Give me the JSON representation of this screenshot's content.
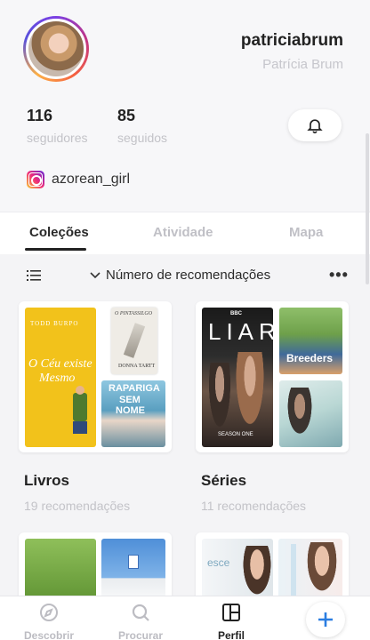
{
  "profile": {
    "username": "patriciabrum",
    "full_name": "Patrícia Brum",
    "followers_count": "116",
    "followers_label": "seguidores",
    "following_count": "85",
    "following_label": "seguidos",
    "instagram_handle": "azorean_girl"
  },
  "tabs": [
    {
      "label": "Coleções",
      "active": true
    },
    {
      "label": "Atividade",
      "active": false
    },
    {
      "label": "Mapa",
      "active": false
    }
  ],
  "sort": {
    "label": "Número de recomendações"
  },
  "collections": [
    {
      "title": "Livros",
      "count": "19 recomendações",
      "covers": {
        "main": {
          "lines": [
            "TODD BURPO",
            "O Céu existe",
            "Mesmo"
          ]
        },
        "top_right": {
          "lines": [
            "O PINTASSILGO",
            "DONNA TARTT"
          ]
        },
        "bottom_right": {
          "lines": [
            "RAPARIGA",
            "SEM",
            "NOME"
          ]
        }
      }
    },
    {
      "title": "Séries",
      "count": "11 recomendações",
      "covers": {
        "main": {
          "lines": [
            "BBC",
            "LIAR",
            "SEASON ONE"
          ]
        },
        "top_right": {
          "lines": [
            "Breeders"
          ]
        },
        "bottom_right": {
          "lines": []
        }
      }
    }
  ],
  "partial_covers": {
    "right_card_text": "esce"
  },
  "bottom_nav": [
    {
      "label": "Descobrir",
      "icon": "compass-icon",
      "active": false
    },
    {
      "label": "Procurar",
      "icon": "search-icon",
      "active": false
    },
    {
      "label": "Perfil",
      "icon": "profile-grid-icon",
      "active": true
    }
  ],
  "colors": {
    "accent": "#2a7de1",
    "text": "#222222",
    "muted": "#c3c3c8"
  }
}
